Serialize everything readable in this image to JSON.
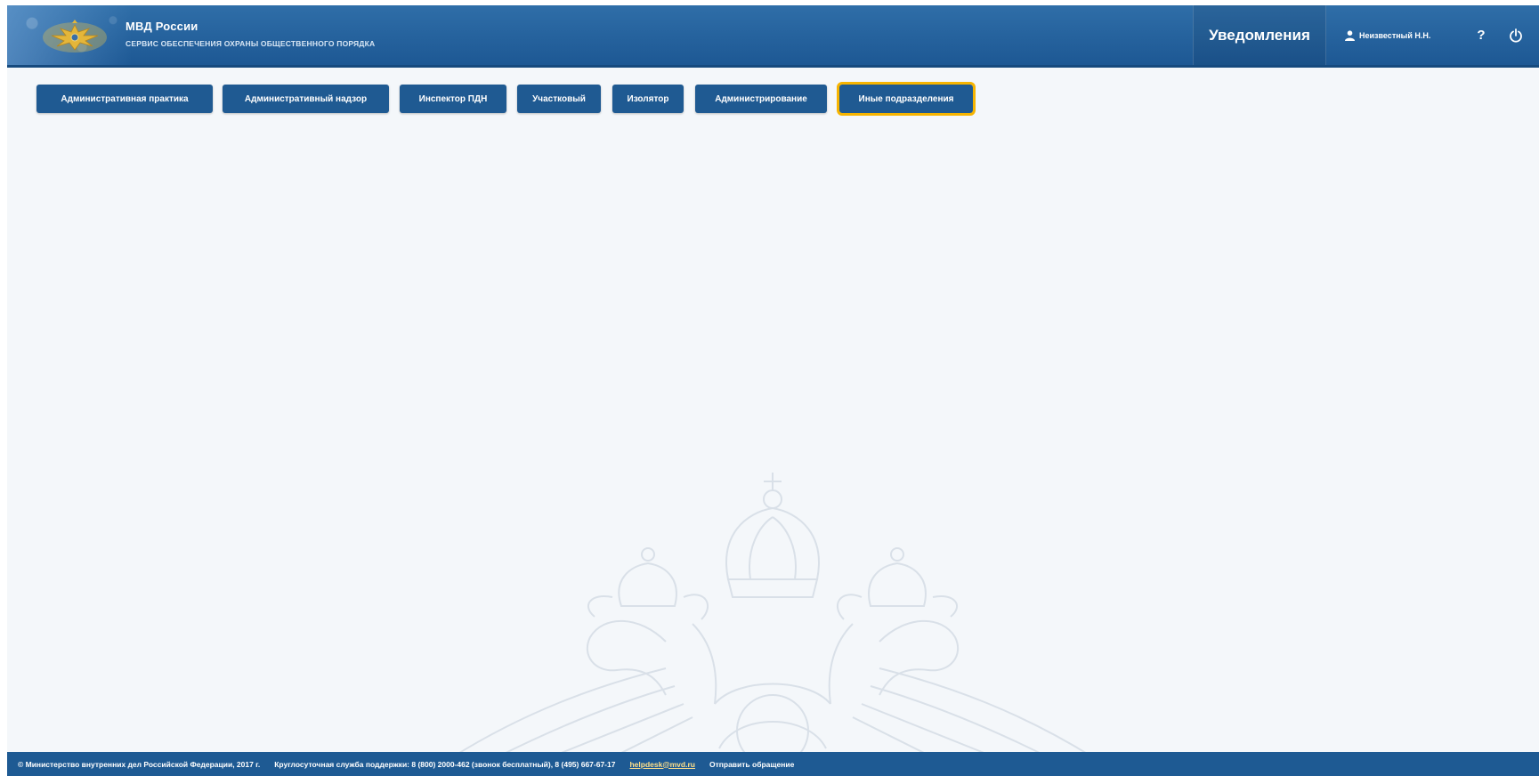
{
  "header": {
    "brand_title": "МВД России",
    "brand_subtitle": "сервис обеспечения охраны общественного порядка",
    "notifications_label": "Уведомления",
    "user_name": "Неизвестный Н.Н.",
    "help_glyph": "?"
  },
  "nav": {
    "items": [
      {
        "label": "Административная практика"
      },
      {
        "label": "Административный надзор"
      },
      {
        "label": "Инспектор ПДН"
      },
      {
        "label": "Участковый"
      },
      {
        "label": "Изолятор"
      },
      {
        "label": "Администрирование"
      },
      {
        "label": "Иные подразделения",
        "active": true
      }
    ]
  },
  "footer": {
    "copyright": "© Министерство внутренних дел Российской Федерации, 2017 г.",
    "support": "Круглосуточная служба поддержки:  8 (800) 2000-462 (звонок бесплатный), 8 (495) 667-67-17",
    "email": "helpdesk@mvd.ru",
    "send_request": "Отправить обращение"
  },
  "colors": {
    "header": "#1d5894",
    "nav_button": "#1f5a92",
    "active_outline": "#f6b400",
    "background": "#f4f7fa",
    "footer": "#1e5a93"
  },
  "icons": {
    "logo": "eagle-emblem-icon",
    "user": "user-icon",
    "help": "help-icon",
    "power": "power-icon",
    "watermark": "double-headed-eagle-watermark"
  }
}
